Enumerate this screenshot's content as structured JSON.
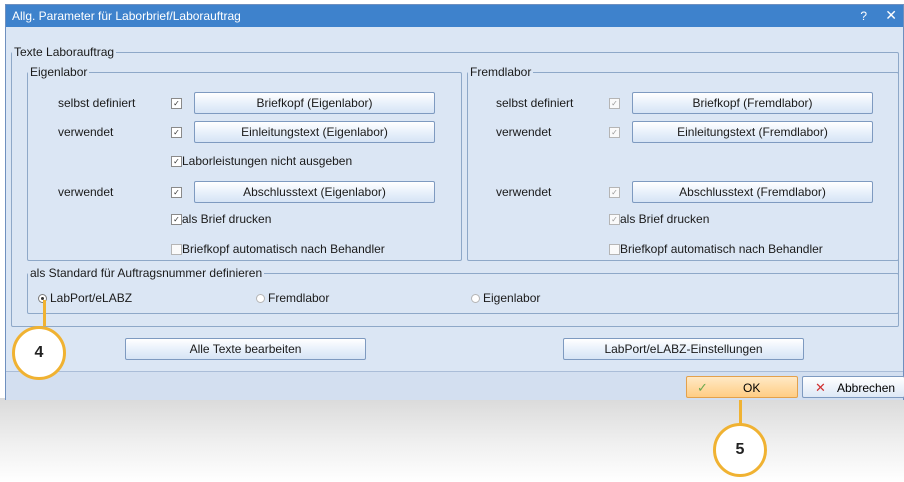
{
  "window": {
    "title": "Allg. Parameter für Laborbrief/Laborauftrag",
    "help": "?",
    "close": "✕"
  },
  "texte_group": {
    "legend": "Texte Laborauftrag"
  },
  "eigenlabor": {
    "legend": "Eigenlabor",
    "row1_label": "selbst definiert",
    "row1_checked": "✓",
    "row1_button": "Briefkopf (Eigenlabor)",
    "row2_label": "verwendet",
    "row2_checked": "✓",
    "row2_button": "Einleitungstext (Eigenlabor)",
    "laborleistungen": "Laborleistungen nicht ausgeben",
    "laborleistungen_checked": "✓",
    "row3_label": "verwendet",
    "row3_checked": "✓",
    "row3_button": "Abschlusstext (Eigenlabor)",
    "als_brief": "als Brief drucken",
    "als_brief_checked": "✓",
    "briefkopf_auto": "Briefkopf automatisch nach Behandler"
  },
  "fremdlabor": {
    "legend": "Fremdlabor",
    "row1_label": "selbst definiert",
    "row1_checked": "✓",
    "row1_button": "Briefkopf (Fremdlabor)",
    "row2_label": "verwendet",
    "row2_checked": "✓",
    "row2_button": "Einleitungstext (Fremdlabor)",
    "row3_label": "verwendet",
    "row3_checked": "✓",
    "row3_button": "Abschlusstext (Fremdlabor)",
    "als_brief": "als Brief drucken",
    "als_brief_checked": "✓",
    "briefkopf_auto": "Briefkopf automatisch nach Behandler"
  },
  "standard": {
    "legend": "als Standard für Auftragsnummer definieren",
    "options": [
      "LabPort/eLABZ",
      "Fremdlabor",
      "Eigenlabor"
    ],
    "selected": "LabPort/eLABZ"
  },
  "buttons": {
    "alle_texte": "Alle Texte bearbeiten",
    "labport_settings": "LabPort/eLABZ-Einstellungen",
    "ok": "OK",
    "cancel": "Abbrechen"
  },
  "icons": {
    "ok": "check-icon",
    "cancel": "x-icon"
  },
  "callouts": {
    "step4": "4",
    "step5": "5"
  },
  "colors": {
    "titlebar": "#3e82cc",
    "dialog_bg": "#dbe6f4",
    "badge_ring": "#f0b232",
    "ok_button": "#ffcd84"
  }
}
